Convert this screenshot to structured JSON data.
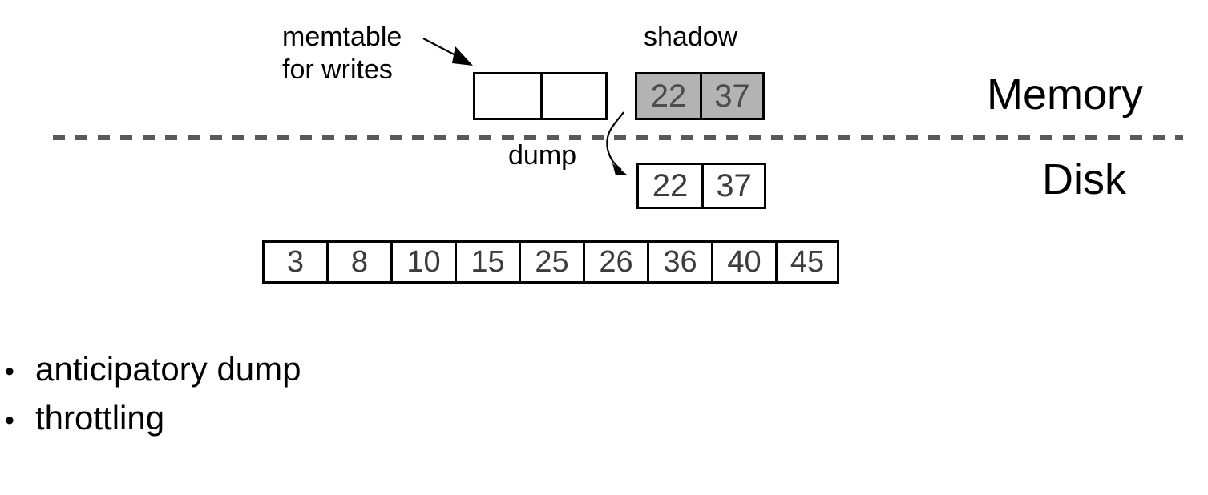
{
  "diagram": {
    "labels": {
      "memtable_line1": "memtable",
      "memtable_line2": "for writes",
      "shadow": "shadow",
      "dump": "dump",
      "memory": "Memory",
      "disk": "Disk"
    },
    "memtable": {
      "name": "memtable for writes",
      "cells": [
        "",
        ""
      ]
    },
    "shadow": {
      "name": "shadow",
      "cells": [
        "22",
        "37"
      ],
      "fill_color": "#b3b3b3",
      "text_color": "#4d4d4d"
    },
    "disk_table": {
      "name": "dumped sstable",
      "cells": [
        "22",
        "37"
      ]
    },
    "sstable": {
      "name": "sstable on disk",
      "cells": [
        "3",
        "8",
        "10",
        "15",
        "25",
        "26",
        "36",
        "40",
        "45"
      ]
    },
    "divider": {
      "name": "memory-disk boundary",
      "color": "#595959"
    },
    "arrows": {
      "memtable_pointer": "memtable-arrow",
      "dump_pointer": "dump-arrow"
    }
  },
  "bullets": [
    {
      "marker": "•",
      "text": "anticipatory dump"
    },
    {
      "marker": "•",
      "text": "throttling"
    }
  ]
}
